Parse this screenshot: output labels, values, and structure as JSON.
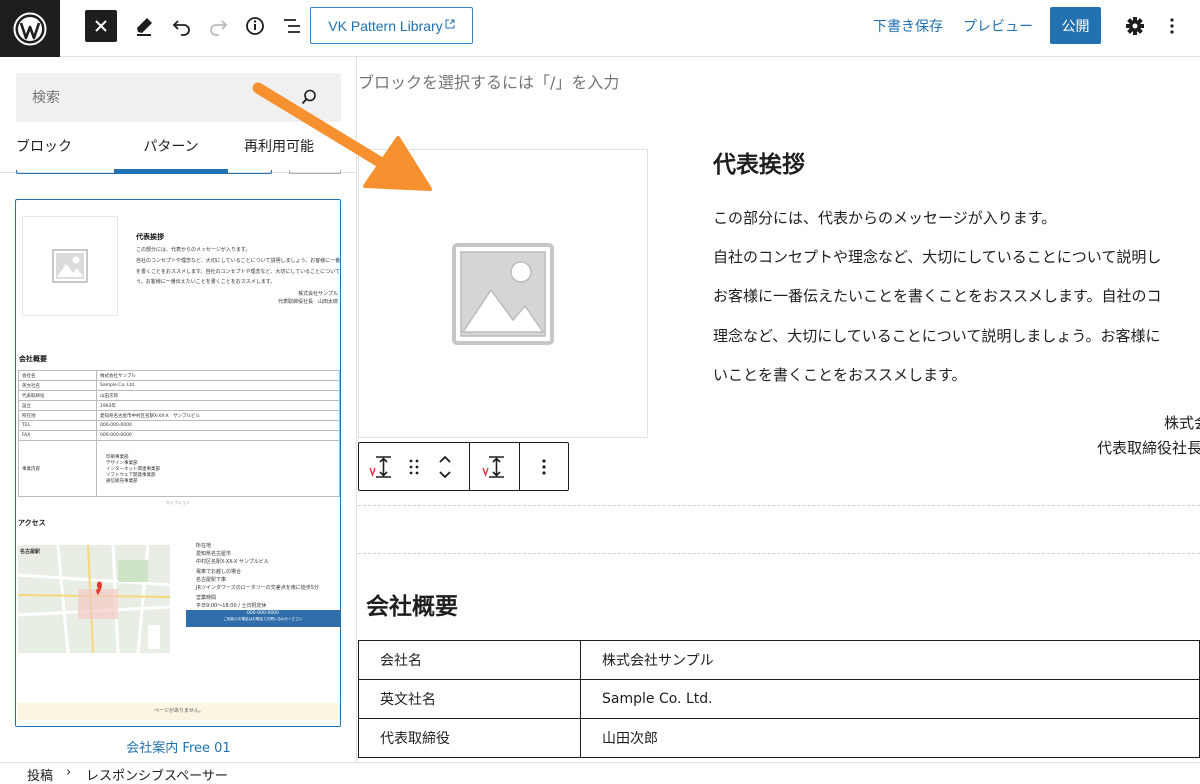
{
  "topbar": {
    "vk_button": "VK Pattern Library",
    "draft": "下書き保存",
    "preview": "プレビュー",
    "publish": "公開",
    "icons": [
      "wordpress-icon",
      "close-icon",
      "pen-icon",
      "undo-icon",
      "redo-icon",
      "info-icon",
      "list-view-icon",
      "external-link-icon",
      "gear-icon",
      "kebab-icon"
    ]
  },
  "inserter": {
    "search_placeholder": "検索",
    "tabs": [
      "ブロック",
      "パターン",
      "再利用可能"
    ],
    "active_tab": "パターン",
    "pattern_name": "会社案内 Free 01",
    "preview": {
      "greeting_title": "代表挨拶",
      "greeting_lines": [
        "この部分には、代表からのメッセージが入ります。",
        "自社のコンセプトや理念など、大切にしていることについて説明しましょう。お客様に一番伝えたいこ",
        "を書くことをおススメします。自社のコンセプトや理念など、大切にしていることについて説明しましょ",
        "う。お客様に一番伝えたいことを書くことをおススメします。"
      ],
      "sig1": "株式会社サンプル",
      "sig2": "代表取締役社長　山田太郎",
      "company_title": "会社概要",
      "rows": [
        [
          "会社名",
          "株式会社サンプル"
        ],
        [
          "英文社名",
          "Sample Co. Ltd."
        ],
        [
          "代表取締役",
          "山田次郎"
        ],
        [
          "設立",
          "1993年"
        ],
        [
          "所在地",
          "愛知県名古屋市中村区名駅X-XX-X　サンプルビル"
        ],
        [
          "TEL",
          "000-000-0000"
        ],
        [
          "FAX",
          "000-000-0000"
        ]
      ],
      "business_label": "事業内容",
      "business_items": [
        "印刷事業部",
        "デザイン事業部",
        "インターネット関連事業部",
        "ソフトウェア開発事業部",
        "通信販売事業部"
      ],
      "caption": "キャプション",
      "access_title": "アクセス",
      "map_place": "名古屋駅",
      "access_items": [
        [
          "所在地",
          "愛知県名古屋市",
          "中村区名駅X-XX-X サンプルビル"
        ],
        [
          "電車でお越しの場合",
          "名古屋駅下車",
          "JRツインタワーズのロータリーの交差点を南に徒歩5分"
        ],
        [
          "営業時間",
          "平日9:00～18:00 / 土日祝定休",
          ""
        ]
      ],
      "cta_line1": "000-000-0000",
      "cta_line2": "ご相談のお電話はお電話でお問い合わせください",
      "footer_note": "ページがありません。"
    }
  },
  "editor": {
    "block_hint": "ブロックを選択するには「/」を入力",
    "greeting_title": "代表挨拶",
    "lines": [
      "この部分には、代表からのメッセージが入ります。",
      "自社のコンセプトや理念など、大切にしていることについて説明し",
      "お客様に一番伝えたいことを書くことをおススメします。自社のコ",
      "理念など、大切にしていることについて説明しましょう。お客様に",
      "いことを書くことをおススメします。"
    ],
    "signature_company": "株式会",
    "signature_person": "代表取締役社長",
    "company_title": "会社概要",
    "table": [
      [
        "会社名",
        "株式会社サンプル"
      ],
      [
        "英文社名",
        "Sample Co. Ltd."
      ],
      [
        "代表取締役",
        "山田次郎"
      ]
    ]
  },
  "breadcrumb": {
    "items": [
      "投稿",
      "レスポンシブスペーサー"
    ],
    "separator": "›"
  },
  "colors": {
    "accent": "#2271b1",
    "dark": "#1e1e1e",
    "annotation_arrow": "#f7902f",
    "vk_red": "#e0333f"
  }
}
